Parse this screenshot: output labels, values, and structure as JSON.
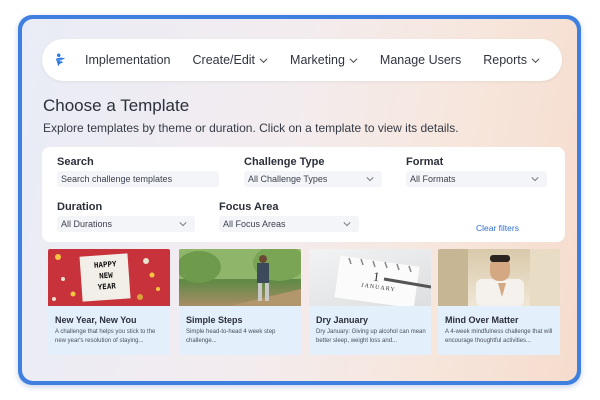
{
  "nav": {
    "items": [
      {
        "label": "Implementation",
        "dropdown": false
      },
      {
        "label": "Create/Edit",
        "dropdown": true
      },
      {
        "label": "Marketing",
        "dropdown": true
      },
      {
        "label": "Manage Users",
        "dropdown": false
      },
      {
        "label": "Reports",
        "dropdown": true
      }
    ]
  },
  "page": {
    "title": "Choose a Template",
    "subtitle": "Explore templates by theme or duration. Click on a template to view its details."
  },
  "filters": {
    "search": {
      "label": "Search",
      "placeholder": "Search challenge templates"
    },
    "challenge_type": {
      "label": "Challenge Type",
      "value": "All Challenge Types"
    },
    "format": {
      "label": "Format",
      "value": "All Formats"
    },
    "duration": {
      "label": "Duration",
      "value": "All Durations"
    },
    "focus_area": {
      "label": "Focus Area",
      "value": "All Focus Areas"
    },
    "clear_label": "Clear filters"
  },
  "cards": [
    {
      "title": "New Year, New You",
      "desc": "A challenge that helps you stick to the new year's resolution of staying...",
      "image_text": [
        "HAPPY",
        "NEW",
        "YEAR"
      ]
    },
    {
      "title": "Simple Steps",
      "desc": "Simple head-to-head 4 week step challenge..."
    },
    {
      "title": "Dry January",
      "desc": "Dry January: Giving up alcohol can mean better sleep, weight loss and...",
      "image_text": [
        "1",
        "JANUARY"
      ]
    },
    {
      "title": "Mind Over Matter",
      "desc": "A 4-week mindfulness challenge that will encourage thoughtful activities..."
    }
  ],
  "colors": {
    "accent": "#2f6fd0",
    "frame": "#3f7fe0",
    "card_bg": "#e3f0fb"
  }
}
